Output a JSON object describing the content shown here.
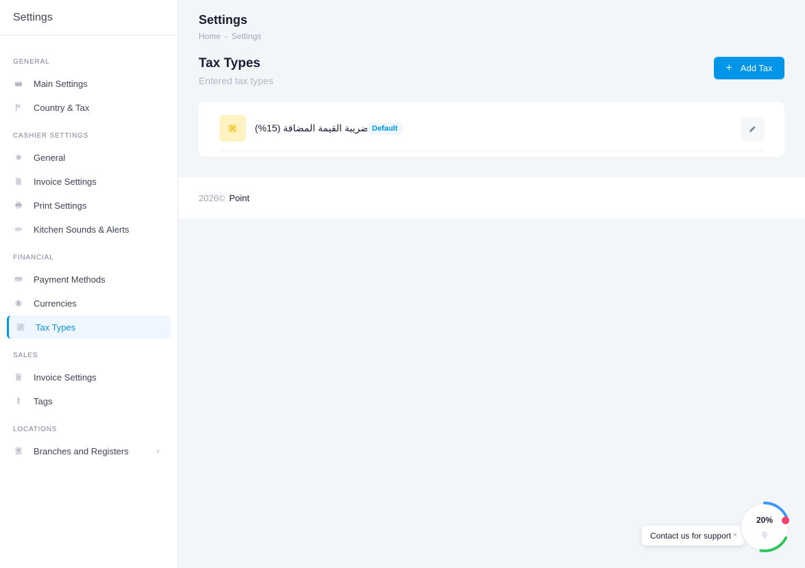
{
  "sidebar": {
    "title": "Settings",
    "sections": [
      {
        "title": "GENERAL",
        "items": [
          {
            "label": "Main Settings",
            "icon": "window-icon"
          },
          {
            "label": "Country & Tax",
            "icon": "flag-icon"
          }
        ]
      },
      {
        "title": "CASHIER SETTINGS",
        "items": [
          {
            "label": "General",
            "icon": "gear-icon"
          },
          {
            "label": "Invoice Settings",
            "icon": "document-icon"
          },
          {
            "label": "Print Settings",
            "icon": "printer-icon"
          },
          {
            "label": "Kitchen Sounds & Alerts",
            "icon": "speaker-icon"
          }
        ]
      },
      {
        "title": "FINANCIAL",
        "items": [
          {
            "label": "Payment Methods",
            "icon": "credit-card-icon"
          },
          {
            "label": "Currencies",
            "icon": "dollar-icon"
          },
          {
            "label": "Tax Types",
            "icon": "percent-icon",
            "active": true
          }
        ]
      },
      {
        "title": "SALES",
        "items": [
          {
            "label": "Invoice Settings",
            "icon": "document-icon"
          },
          {
            "label": "Tags",
            "icon": "tag-icon"
          }
        ]
      },
      {
        "title": "LOCATIONS",
        "items": [
          {
            "label": "Branches and Registers",
            "icon": "building-icon",
            "chevron": "›"
          }
        ]
      }
    ]
  },
  "header": {
    "title": "Settings",
    "breadcrumb": [
      "Home",
      "-",
      "Settings"
    ]
  },
  "main": {
    "section_title": "Tax Types",
    "section_subtitle": "Entered tax types",
    "add_button_icon": "+",
    "add_button_label": "Add Tax",
    "taxes": [
      {
        "name": "ضريبة القيمة المضافة (15%)",
        "badge": "Default"
      }
    ]
  },
  "footer": {
    "year": "2026©",
    "brand": "Point"
  },
  "support": {
    "label": "Contact us for support",
    "close": "×",
    "progress_text": "20%",
    "progress_value": 0.2
  },
  "colors": {
    "accent": "#0095e8",
    "active_bg": "#eef6ff",
    "tax_icon_bg": "#fff3c4",
    "progress_blue": "#3e97ff",
    "progress_green": "#2fc55e",
    "notify_red": "#f1416c"
  }
}
